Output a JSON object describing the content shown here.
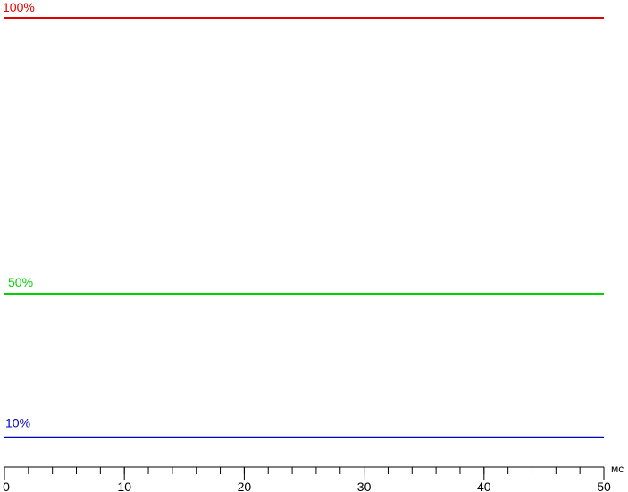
{
  "chart_data": {
    "type": "line",
    "title": "",
    "xlabel": "",
    "ylabel": "",
    "x_unit": "мс",
    "xlim": [
      0,
      50
    ],
    "x_ticks": [
      0,
      10,
      20,
      30,
      40,
      50
    ],
    "x_minor_step": 2,
    "ylim": [
      0,
      105
    ],
    "grid": false,
    "legend": "none",
    "series": [
      {
        "name": "100%",
        "color": "#e00000",
        "x": [
          0,
          50
        ],
        "y": [
          100,
          100
        ]
      },
      {
        "name": "50%",
        "color": "#00d000",
        "x": [
          0,
          50
        ],
        "y": [
          50,
          50
        ]
      },
      {
        "name": "10%",
        "color": "#0000c0",
        "x": [
          0,
          50
        ],
        "y": [
          24,
          24
        ]
      }
    ]
  }
}
